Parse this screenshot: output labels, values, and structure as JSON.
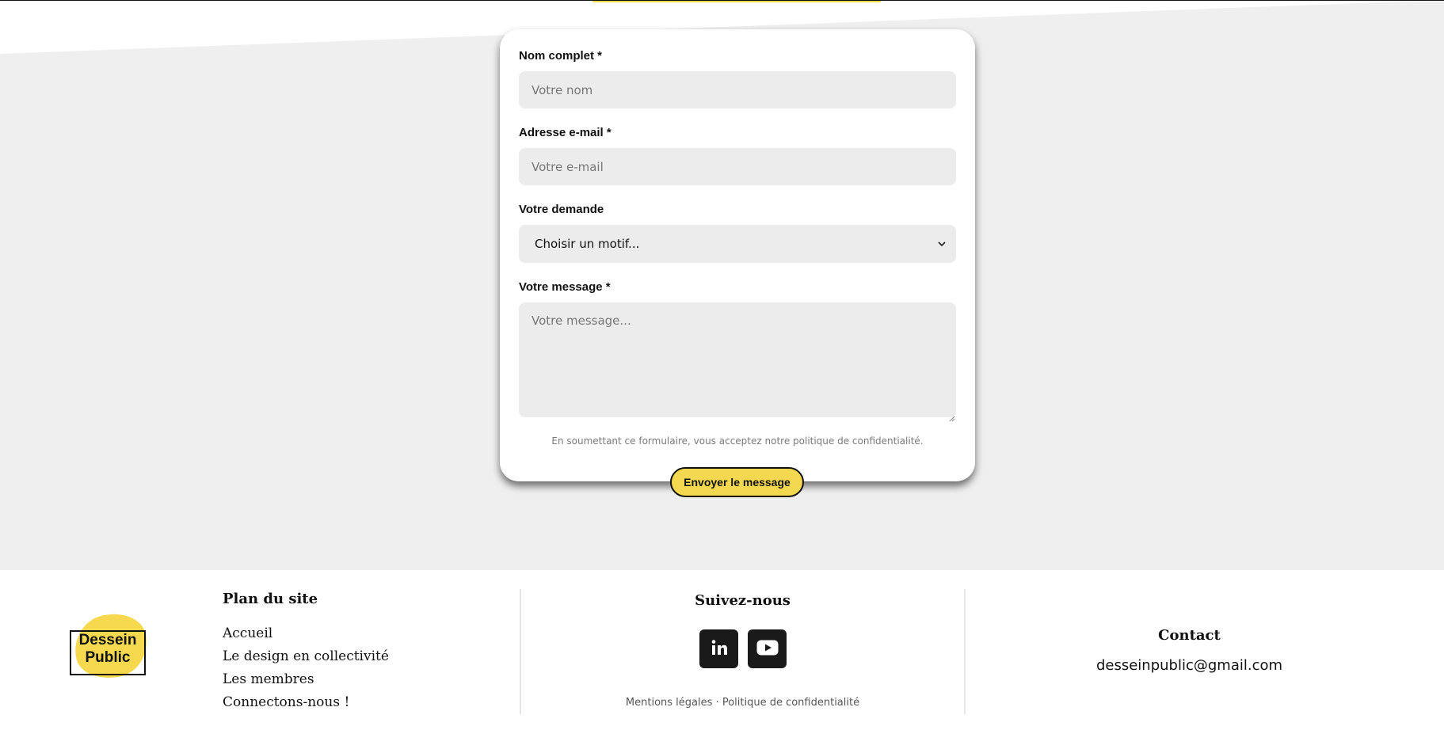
{
  "form": {
    "name_label": "Nom complet *",
    "name_placeholder": "Votre nom",
    "email_label": "Adresse e-mail *",
    "email_placeholder": "Votre e-mail",
    "request_label": "Votre demande",
    "request_selected": "Choisir un motif...",
    "message_label": "Votre message *",
    "message_placeholder": "Votre message...",
    "privacy_note": "En soumettant ce formulaire, vous acceptez notre politique de confidentialité.",
    "submit_label": "Envoyer le message"
  },
  "footer": {
    "logo_line1": "Dessein",
    "logo_line2": "Public",
    "sitemap_title": "Plan du site",
    "sitemap_links": [
      "Accueil",
      "Le design en collectivité",
      "Les membres",
      "Connectons-nous !"
    ],
    "follow_title": "Suivez-nous",
    "socials": [
      {
        "name": "linkedin-icon",
        "label": "in"
      },
      {
        "name": "youtube-icon",
        "label": "▶"
      }
    ],
    "legal_mentions": "Mentions légales",
    "legal_separator": "·",
    "legal_privacy": "Politique de confidentialité",
    "contact_title": "Contact",
    "contact_email": "desseinpublic@gmail.com"
  },
  "colors": {
    "accent_yellow": "#f4d84f",
    "background_grey": "#efefef",
    "field_grey": "#ececec",
    "text_dark": "#111111"
  }
}
